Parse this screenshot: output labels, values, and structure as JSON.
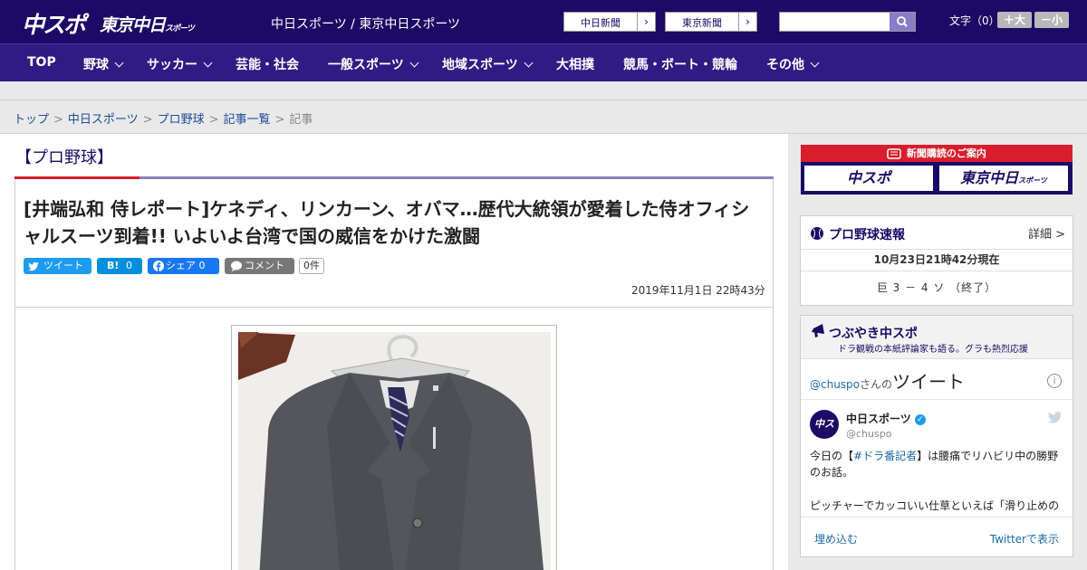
{
  "header": {
    "logo_chunichi_sports": "中スポ",
    "logo_tokyo_chunichi": "東京中日",
    "logo_tokyo_chunichi_small": "スポーツ",
    "site_names": "中日スポーツ / 東京中日スポーツ",
    "link_chunichi_shimbun": "中日新聞",
    "link_tokyo_shimbun": "東京新聞",
    "search_placeholder": "",
    "font_size_label": "文字（0）",
    "font_bigger": "＋大",
    "font_smaller": "－小"
  },
  "nav": {
    "items": [
      {
        "label": "TOP"
      },
      {
        "label": "野球"
      },
      {
        "label": "サッカー"
      },
      {
        "label": "芸能・社会"
      },
      {
        "label": "一般スポーツ"
      },
      {
        "label": "地域スポーツ"
      },
      {
        "label": "大相撲"
      },
      {
        "label": "競馬・ボート・競輪"
      },
      {
        "label": "その他"
      }
    ]
  },
  "breadcrumb": {
    "items": [
      "トップ",
      "中日スポーツ",
      "プロ野球",
      "記事一覧"
    ],
    "current": "記事",
    "separator": ">"
  },
  "article": {
    "category": "【プロ野球】",
    "headline": "[井端弘和 侍レポート]ケネディ、リンカーン、オバマ…歴代大統領が愛着した侍オフィシャルスーツ到着!! いよいよ台湾で国の威信をかけた激闘",
    "tweet_label": "ツイート",
    "hatena_label": "B!",
    "hatena_count": "0",
    "fb_label": "シェア",
    "fb_count": "0",
    "comment_label": "コメント",
    "comment_count": "0件",
    "datetime": "2019年11月1日 22時43分"
  },
  "sidebar": {
    "subscription_title": "新聞購読のご案内",
    "sub_logo_chunichi": "中スポ",
    "sub_logo_tokyo": "東京中日",
    "sub_logo_tokyo_small": "スポーツ",
    "score": {
      "title": "プロ野球速報",
      "detail": "詳細 >",
      "time": "10月23日21時42分現在",
      "result": "巨 3 － 4 ソ （終了）"
    },
    "tweets": {
      "title": "つぶやき中スポ",
      "subtitle": "ドラ観戦の本紙評論家も語る。グラも熱烈応援",
      "handle_link": "@chuspo",
      "handle_suffix": "さんの",
      "heading": "ツイート",
      "info": "i",
      "avatar_text": "中スポ",
      "user_name": "中日スポーツ",
      "user_handle": "@chuspo",
      "text1_pre": "今日の【",
      "text1_tag": "#ドラ番記者",
      "text1_post": "】は腰痛でリハビリ中の勝野のお話。",
      "text2": "ピッチャーでカッコいい仕草といえば「滑り止めの",
      "embed": "埋め込む",
      "view_on_twitter": "Twitterで表示"
    }
  }
}
